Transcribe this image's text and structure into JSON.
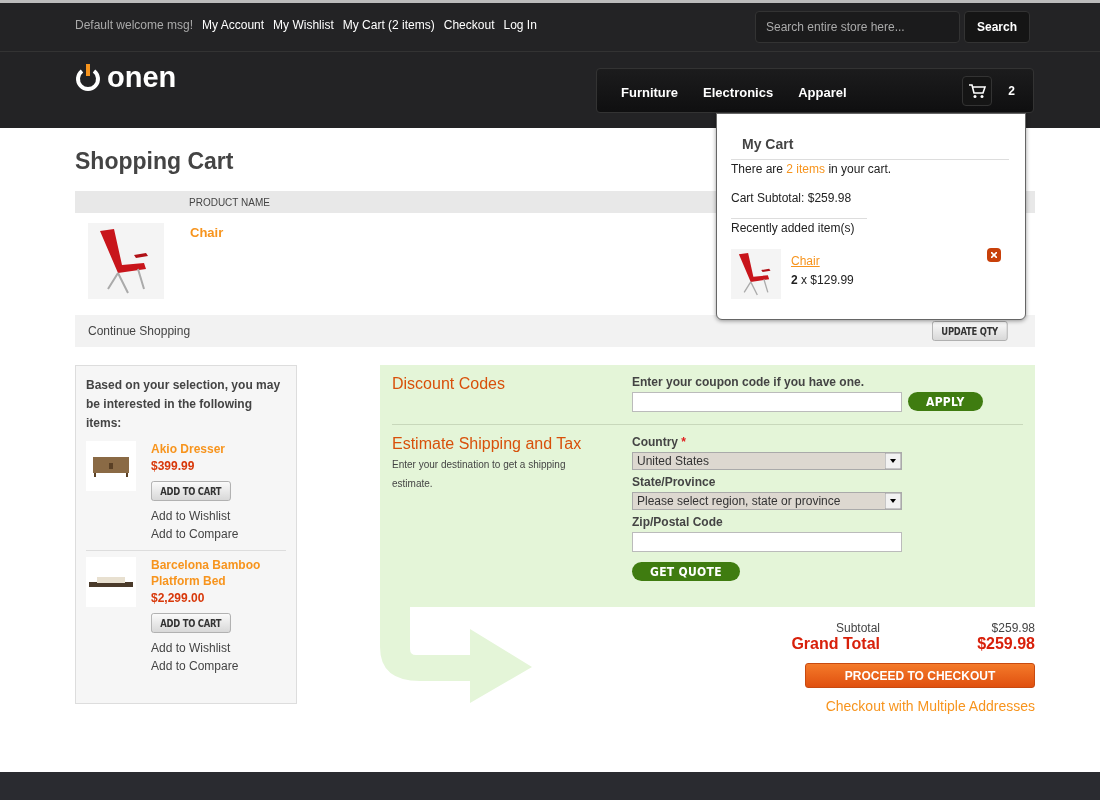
{
  "top_links": {
    "welcome": "Default welcome msg!",
    "links": [
      "My Account",
      "My Wishlist",
      "My Cart (2 items)",
      "Checkout",
      "Log In"
    ]
  },
  "search": {
    "placeholder": "Search entire store here...",
    "button": "Search"
  },
  "logo": {
    "text": "onen"
  },
  "nav": {
    "items": [
      "Furniture",
      "Electronics",
      "Apparel"
    ],
    "cart_count": "2"
  },
  "page_title": "Shopping Cart",
  "cart_table": {
    "columns": [
      "PRODUCT NAME"
    ],
    "rows": [
      {
        "name": "Chair"
      }
    ],
    "continue": "Continue Shopping",
    "update": "UPDATE QTY"
  },
  "mini_cart": {
    "title": "My Cart",
    "summary": {
      "before": "There are ",
      "link": "2 items",
      "after": " in your cart."
    },
    "subtotal": "Cart Subtotal: $259.98",
    "recent_title": "Recently added item(s)",
    "items": [
      {
        "name": "Chair",
        "qty_price": "**2** x $129.99"
      }
    ]
  },
  "crosssell": {
    "title": "Based on your selection, you may be interested in the following items:",
    "items": [
      {
        "name": "Akio Dresser",
        "price": "$399.99",
        "kind": "dresser",
        "add": "ADD TO CART",
        "wishlist": "Add to Wishlist",
        "compare": "Add to Compare"
      },
      {
        "name": "Barcelona Bamboo Platform Bed",
        "price": "$2,299.00",
        "kind": "bed",
        "add": "ADD TO CART",
        "wishlist": "Add to Wishlist",
        "compare": "Add to Compare"
      }
    ]
  },
  "discount": {
    "title": "Discount Codes",
    "label": "Enter your coupon code if you have one.",
    "button": "APPLY"
  },
  "shipping": {
    "title": "Estimate Shipping and Tax",
    "note": "Enter your destination to get a shipping estimate.",
    "country_label": "Country",
    "required_mark": "*",
    "country": "United States",
    "state_label": "State/Province",
    "state": "Please select region, state or province",
    "zip_label": "Zip/Postal Code",
    "button": "GET QUOTE"
  },
  "totals": {
    "subtotal_label": "Subtotal",
    "subtotal": "$259.98",
    "grand_label": "Grand Total",
    "grand": "$259.98",
    "checkout": "PROCEED TO CHECKOUT",
    "multi": "Checkout with Multiple Addresses"
  }
}
